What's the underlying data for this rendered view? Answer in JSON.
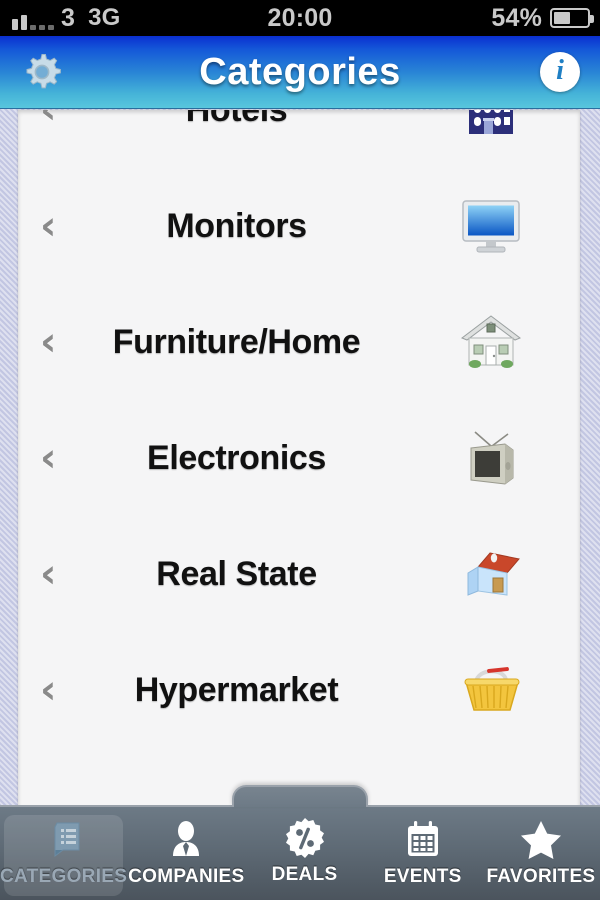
{
  "status_bar": {
    "carrier": "3",
    "network": "3G",
    "time": "20:00",
    "battery_percent": "54%",
    "signal_icon": "signal-bars-icon",
    "battery_icon": "battery-icon"
  },
  "navbar": {
    "title": "Categories",
    "left_icon": "gear-icon",
    "right_icon": "info-icon",
    "gradient_top": "#0a2fd0",
    "gradient_bottom": "#58c6dd"
  },
  "list": {
    "rows": [
      {
        "label": "Hotels",
        "icon": "hotel-building-icon",
        "chevron": "‹"
      },
      {
        "label": "Monitors",
        "icon": "computer-monitor-icon",
        "chevron": "‹"
      },
      {
        "label": "Furniture/Home",
        "icon": "house-icon",
        "chevron": "‹"
      },
      {
        "label": "Electronics",
        "icon": "television-icon",
        "chevron": "‹"
      },
      {
        "label": "Real State",
        "icon": "home-red-roof-icon",
        "chevron": "‹"
      },
      {
        "label": "Hypermarket",
        "icon": "shopping-basket-icon",
        "chevron": "‹"
      }
    ]
  },
  "tabbar": {
    "active_index": 0,
    "items": [
      {
        "label": "CATEGORIES",
        "icon": "list-document-icon"
      },
      {
        "label": "COMPANIES",
        "icon": "businessperson-icon"
      },
      {
        "label": "DEALS",
        "icon": "percent-badge-icon"
      },
      {
        "label": "EVENTS",
        "icon": "calendar-icon"
      },
      {
        "label": "FAVORITES",
        "icon": "star-icon"
      }
    ],
    "active_color": "#9aa8b5",
    "label_color": "#ffffff"
  }
}
